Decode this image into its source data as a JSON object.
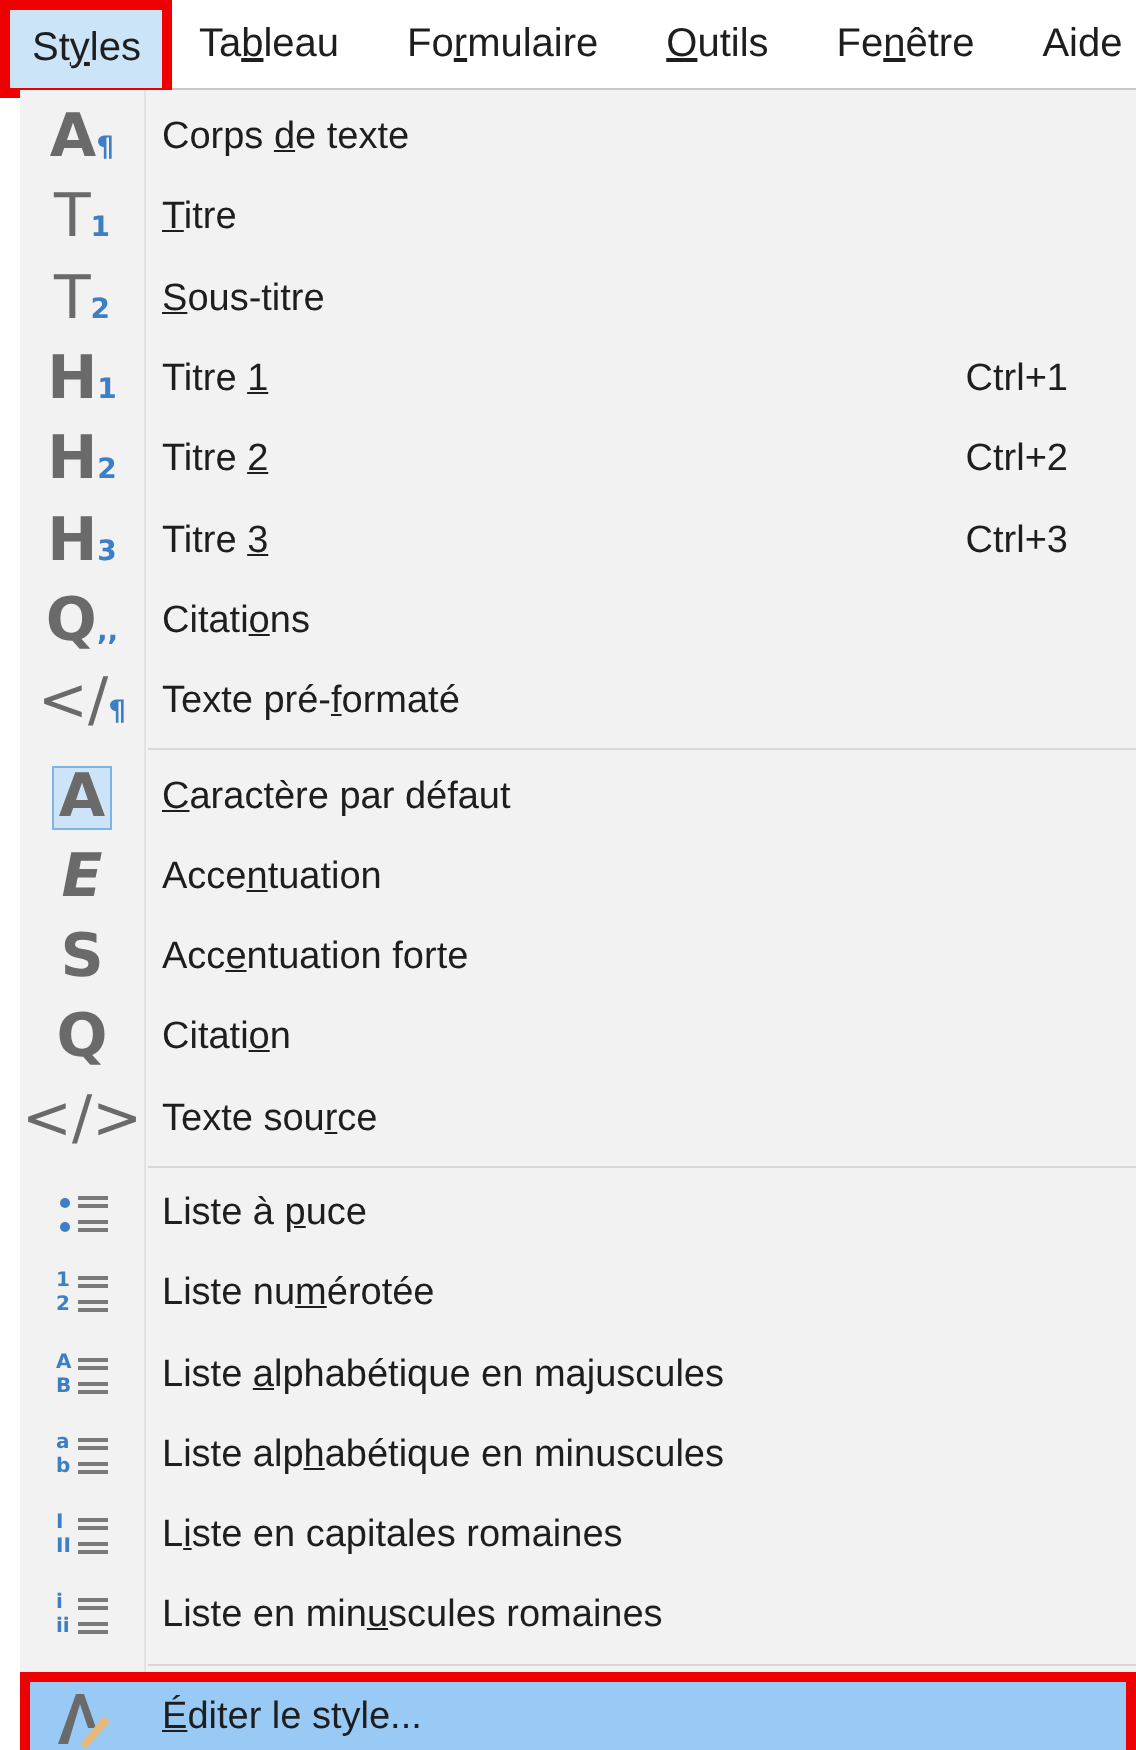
{
  "menubar": [
    {
      "label": {
        "pre": "St",
        "key": "y",
        "post": "les"
      },
      "selected": true,
      "annotated": true
    },
    {
      "label": {
        "pre": "Ta",
        "key": "b",
        "post": "leau"
      },
      "selected": false,
      "annotated": false
    },
    {
      "label": {
        "pre": "Fo",
        "key": "r",
        "post": "mulaire"
      },
      "selected": false,
      "annotated": false
    },
    {
      "label": {
        "key": "O",
        "post": "utils"
      },
      "selected": false,
      "annotated": false
    },
    {
      "label": {
        "pre": "Fe",
        "key": "n",
        "post": "être"
      },
      "selected": false,
      "annotated": false
    },
    {
      "label": {
        "pre": "Aide"
      },
      "selected": false,
      "annotated": false
    }
  ],
  "menu": {
    "sections": [
      {
        "items": [
          {
            "icon": {
              "kind": "heavy",
              "glyph": "A",
              "sub": "¶"
            },
            "label": {
              "pre": "Corps ",
              "key": "d",
              "post": "e texte"
            },
            "checked": false,
            "selected": false,
            "annotated": false
          },
          {
            "icon": {
              "kind": "light",
              "glyph": "T",
              "sub": "1"
            },
            "label": {
              "key": "T",
              "post": "itre"
            },
            "checked": false,
            "selected": false,
            "annotated": false
          },
          {
            "icon": {
              "kind": "light",
              "glyph": "T",
              "sub": "2"
            },
            "label": {
              "key": "S",
              "post": "ous-titre"
            },
            "checked": false,
            "selected": false,
            "annotated": false
          },
          {
            "icon": {
              "kind": "heavy",
              "glyph": "H",
              "sub": "1"
            },
            "label": {
              "pre": "Titre ",
              "key": "1"
            },
            "shortcut": "Ctrl+1",
            "checked": false,
            "selected": false,
            "annotated": false
          },
          {
            "icon": {
              "kind": "heavy",
              "glyph": "H",
              "sub": "2"
            },
            "label": {
              "pre": "Titre ",
              "key": "2"
            },
            "shortcut": "Ctrl+2",
            "checked": false,
            "selected": false,
            "annotated": false
          },
          {
            "icon": {
              "kind": "heavy",
              "glyph": "H",
              "sub": "3"
            },
            "label": {
              "pre": "Titre ",
              "key": "3"
            },
            "shortcut": "Ctrl+3",
            "checked": false,
            "selected": false,
            "annotated": false
          },
          {
            "icon": {
              "kind": "heavy",
              "glyph": "Q",
              "sub": ",,"
            },
            "label": {
              "pre": "Citati",
              "key": "o",
              "post": "ns"
            },
            "checked": false,
            "selected": false,
            "annotated": false
          },
          {
            "icon": {
              "kind": "light",
              "glyph": "</",
              "sub": "¶"
            },
            "label": {
              "pre": "Texte pré-",
              "key": "f",
              "post": "ormaté"
            },
            "checked": false,
            "selected": false,
            "annotated": false
          }
        ]
      },
      {
        "items": [
          {
            "icon": {
              "kind": "heavy",
              "glyph": "A"
            },
            "label": {
              "key": "C",
              "post": "aractère par défaut"
            },
            "checked": true,
            "selected": false,
            "annotated": false
          },
          {
            "icon": {
              "kind": "slanted",
              "glyph": "E"
            },
            "label": {
              "pre": "Acce",
              "key": "n",
              "post": "tuation"
            },
            "checked": false,
            "selected": false,
            "annotated": false
          },
          {
            "icon": {
              "kind": "heavy",
              "glyph": "S"
            },
            "label": {
              "pre": "Acc",
              "key": "e",
              "post": "ntuation forte"
            },
            "checked": false,
            "selected": false,
            "annotated": false
          },
          {
            "icon": {
              "kind": "heavy",
              "glyph": "Q"
            },
            "label": {
              "pre": "Citati",
              "key": "o",
              "post": "n"
            },
            "checked": false,
            "selected": false,
            "annotated": false
          },
          {
            "icon": {
              "kind": "light",
              "glyph": "</>"
            },
            "label": {
              "pre": "Texte sou",
              "key": "r",
              "post": "ce"
            },
            "checked": false,
            "selected": false,
            "annotated": false
          }
        ]
      },
      {
        "items": [
          {
            "icon": {
              "kind": "list"
            },
            "label": {
              "pre": "Liste à ",
              "key": "p",
              "post": "uce"
            },
            "checked": false,
            "selected": false,
            "annotated": false
          },
          {
            "icon": {
              "kind": "list",
              "marks": [
                "1",
                "2"
              ]
            },
            "label": {
              "pre": "Liste nu",
              "key": "m",
              "post": "érotée"
            },
            "checked": false,
            "selected": false,
            "annotated": false
          },
          {
            "icon": {
              "kind": "list",
              "marks": [
                "A",
                "B"
              ]
            },
            "label": {
              "pre": "Liste ",
              "key": "a",
              "post": "lphabétique en majuscules"
            },
            "checked": false,
            "selected": false,
            "annotated": false
          },
          {
            "icon": {
              "kind": "list",
              "marks": [
                "a",
                "b"
              ]
            },
            "label": {
              "pre": "Liste alp",
              "key": "h",
              "post": "abétique en minuscules"
            },
            "checked": false,
            "selected": false,
            "annotated": false
          },
          {
            "icon": {
              "kind": "list",
              "marks": [
                "I",
                "II"
              ]
            },
            "label": {
              "pre": "L",
              "key": "i",
              "post": "ste en capitales romaines"
            },
            "checked": false,
            "selected": false,
            "annotated": false
          },
          {
            "icon": {
              "kind": "list",
              "marks": [
                "i",
                "ii"
              ]
            },
            "label": {
              "pre": "Liste en min",
              "key": "u",
              "post": "scules romaines"
            },
            "checked": false,
            "selected": false,
            "annotated": false
          }
        ]
      },
      {
        "items": [
          {
            "icon": {
              "kind": "edit"
            },
            "label": {
              "key": "É",
              "post": "diter le style..."
            },
            "checked": false,
            "selected": true,
            "annotated": true
          }
        ]
      }
    ]
  }
}
